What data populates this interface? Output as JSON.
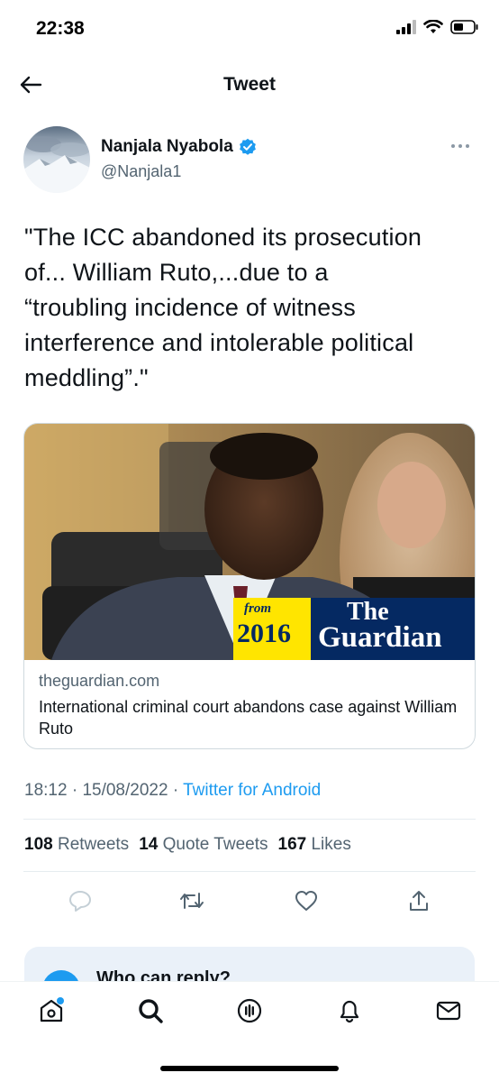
{
  "status_bar": {
    "time": "22:38"
  },
  "header": {
    "title": "Tweet",
    "back_icon": "arrow-left-icon"
  },
  "author": {
    "name": "Nanjala Nyabola",
    "handle": "@Nanjala1",
    "verified": true,
    "verified_color": "#1d9bf0"
  },
  "tweet": {
    "lines": [
      "\"The ICC  abandoned its prosecution",
      "of... William Ruto,...due to a",
      "“troubling incidence of witness",
      "interference and intolerable political",
      "meddling”.\""
    ]
  },
  "card": {
    "badge_from": "from",
    "badge_year": "2016",
    "badge_brand_line1": "The",
    "badge_brand_line2": "Guardian",
    "domain": "theguardian.com",
    "title": "International criminal court abandons case against William Ruto"
  },
  "meta": {
    "time": "18:12",
    "date": "15/08/2022",
    "source": "Twitter for Android"
  },
  "stats": {
    "retweets_count": "108",
    "retweets_label": "Retweets",
    "quotes_count": "14",
    "quotes_label": "Quote Tweets",
    "likes_count": "167",
    "likes_label": "Likes"
  },
  "reply_settings": {
    "title": "Who can reply?"
  },
  "colors": {
    "accent": "#1d9bf0",
    "text": "#0f1419",
    "muted": "#536471",
    "guardian_blue": "#052962",
    "guardian_yellow": "#ffe500"
  }
}
